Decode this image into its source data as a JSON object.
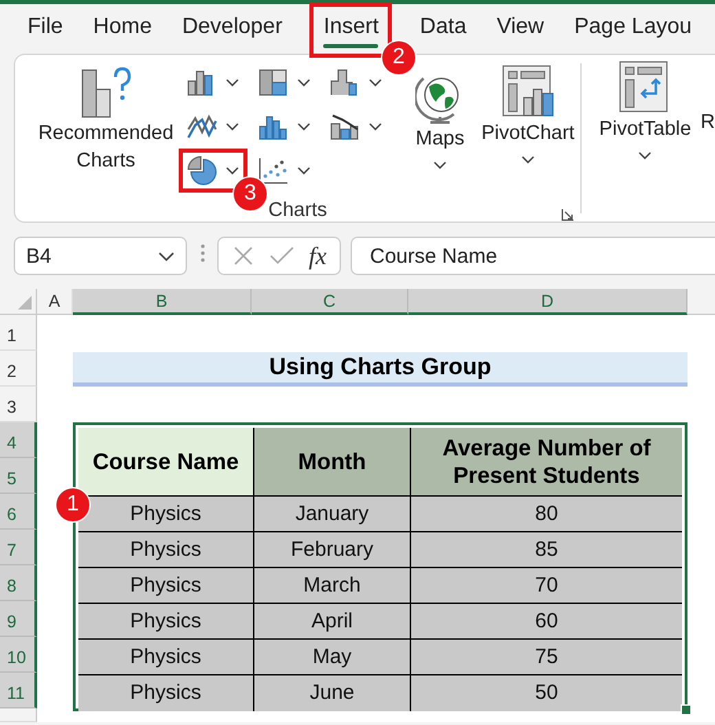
{
  "menu_tabs": [
    {
      "label": "File",
      "selected": false,
      "highlighted": false
    },
    {
      "label": "Home",
      "selected": false,
      "highlighted": false
    },
    {
      "label": "Developer",
      "selected": false,
      "highlighted": false
    },
    {
      "label": "Insert",
      "selected": true,
      "highlighted": true
    },
    {
      "label": "Data",
      "selected": false,
      "highlighted": false
    },
    {
      "label": "View",
      "selected": false,
      "highlighted": false
    },
    {
      "label": "Page Layou",
      "selected": false,
      "highlighted": false
    }
  ],
  "ribbon": {
    "recommended_charts": "Recommended Charts",
    "chart_types": [
      {
        "kind": "column",
        "highlighted": false
      },
      {
        "kind": "hierarchy",
        "highlighted": false
      },
      {
        "kind": "waterfall",
        "highlighted": false
      },
      {
        "kind": "line",
        "highlighted": false
      },
      {
        "kind": "statistic",
        "highlighted": false
      },
      {
        "kind": "combo",
        "highlighted": false
      },
      {
        "kind": "pie",
        "highlighted": true
      },
      {
        "kind": "scatter",
        "highlighted": false
      }
    ],
    "maps": "Maps",
    "pivot_chart": "PivotChart",
    "pivot_table": "PivotTable",
    "next_button": "R",
    "group_label": "Charts"
  },
  "formula_bar": {
    "name_box": "B4",
    "function_symbol": "fx",
    "formula": "Course Name"
  },
  "column_headers": [
    {
      "label": "A",
      "selected": false
    },
    {
      "label": "B",
      "selected": true
    },
    {
      "label": "C",
      "selected": true
    },
    {
      "label": "D",
      "selected": true
    }
  ],
  "row_headers": [
    {
      "label": "1",
      "selected": false
    },
    {
      "label": "2",
      "selected": false
    },
    {
      "label": "3",
      "selected": false
    },
    {
      "label": "4",
      "selected": true
    },
    {
      "label": "5",
      "selected": true
    },
    {
      "label": "6",
      "selected": true
    },
    {
      "label": "7",
      "selected": true
    },
    {
      "label": "8",
      "selected": true
    },
    {
      "label": "9",
      "selected": true
    },
    {
      "label": "10",
      "selected": true
    },
    {
      "label": "11",
      "selected": true
    }
  ],
  "title": "Using Charts Group",
  "table": {
    "columns": [
      {
        "label": "Course Name",
        "active": true
      },
      {
        "label": "Month",
        "active": false
      },
      {
        "label": "Average Number of Present Students",
        "active": false
      }
    ],
    "rows": [
      [
        "Physics",
        "January",
        "80"
      ],
      [
        "Physics",
        "February",
        "85"
      ],
      [
        "Physics",
        "March",
        "70"
      ],
      [
        "Physics",
        "April",
        "60"
      ],
      [
        "Physics",
        "May",
        "75"
      ],
      [
        "Physics",
        "June",
        "50"
      ]
    ]
  },
  "callouts": [
    "1",
    "2",
    "3"
  ]
}
